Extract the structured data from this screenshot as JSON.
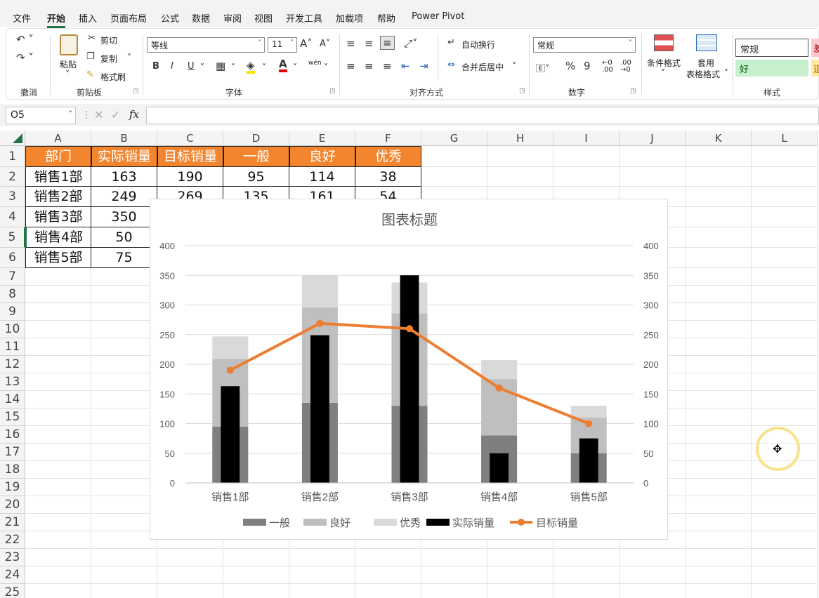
{
  "menu": {
    "items": [
      "文件",
      "开始",
      "插入",
      "页面布局",
      "公式",
      "数据",
      "审阅",
      "视图",
      "开发工具",
      "加载项",
      "帮助",
      "Power Pivot"
    ],
    "active_index": 1
  },
  "ribbon": {
    "undo_label": "撤消",
    "clipboard": {
      "paste": "粘贴",
      "cut": "剪切",
      "copy": "复制",
      "format_painter": "格式刷",
      "label": "剪贴板"
    },
    "font": {
      "name": "等线",
      "size": "11",
      "label": "字体",
      "bold": "B",
      "italic": "I",
      "underline": "U",
      "grow": "A",
      "shrink": "A",
      "phonetic": "wén"
    },
    "alignment": {
      "wrap_text": "自动换行",
      "merge_center": "合并后居中",
      "label": "对齐方式"
    },
    "number": {
      "format": "常规",
      "percent": "%",
      "comma": "9",
      "label": "数字"
    },
    "cond_format": "条件格式",
    "table_format_l1": "套用",
    "table_format_l2": "表格格式",
    "styles": {
      "normal": "常规",
      "good": "好",
      "bad": "差",
      "neutral": "适",
      "label": "样式"
    }
  },
  "formula_bar": {
    "name_box": "O5",
    "fx": "fx",
    "formula": ""
  },
  "grid": {
    "columns": [
      "A",
      "B",
      "C",
      "D",
      "E",
      "F",
      "G",
      "H",
      "I",
      "J",
      "K",
      "L"
    ],
    "rows": [
      "1",
      "2",
      "3",
      "4",
      "5",
      "6",
      "7",
      "8",
      "9",
      "10",
      "11",
      "12",
      "13",
      "14",
      "15",
      "16",
      "17",
      "18",
      "19",
      "20",
      "21",
      "22",
      "23",
      "24",
      "25"
    ],
    "selected_row": "5",
    "table_header": [
      "部门",
      "实际销量",
      "目标销量",
      "一般",
      "良好",
      "优秀"
    ],
    "table_rows": [
      [
        "销售1部",
        "163",
        "190",
        "95",
        "114",
        "38"
      ],
      [
        "销售2部",
        "249",
        "269",
        "135",
        "161",
        "54"
      ],
      [
        "销售3部",
        "350",
        "",
        "",
        "",
        ""
      ],
      [
        "销售4部",
        "50",
        "",
        "",
        "",
        ""
      ],
      [
        "销售5部",
        "75",
        "",
        "",
        "",
        ""
      ]
    ]
  },
  "chart_data": {
    "type": "bar",
    "title": "图表标题",
    "categories": [
      "销售1部",
      "销售2部",
      "销售3部",
      "销售4部",
      "销售5部"
    ],
    "ylim": [
      0,
      400
    ],
    "yticks": [
      "0",
      "50",
      "100",
      "150",
      "200",
      "250",
      "300",
      "350",
      "400"
    ],
    "y2ticks": [
      "0",
      "50",
      "100",
      "150",
      "200",
      "250",
      "300",
      "350",
      "400"
    ],
    "series": [
      {
        "name": "一般",
        "kind": "stacked-bar",
        "color": "#7f7f7f",
        "values": [
          95,
          135,
          130,
          80,
          50
        ]
      },
      {
        "name": "良好",
        "kind": "stacked-bar",
        "color": "#bfbfbf",
        "values": [
          114,
          161,
          156,
          95,
          60
        ]
      },
      {
        "name": "优秀",
        "kind": "stacked-bar",
        "color": "#d9d9d9",
        "values": [
          38,
          54,
          52,
          32,
          20
        ]
      },
      {
        "name": "实际销量",
        "kind": "bar",
        "color": "#000000",
        "values": [
          163,
          249,
          350,
          50,
          75
        ]
      },
      {
        "name": "目标销量",
        "kind": "line",
        "color": "#ed7d31",
        "values": [
          190,
          269,
          260,
          160,
          100
        ]
      }
    ],
    "legend_position": "bottom",
    "grid": true
  }
}
